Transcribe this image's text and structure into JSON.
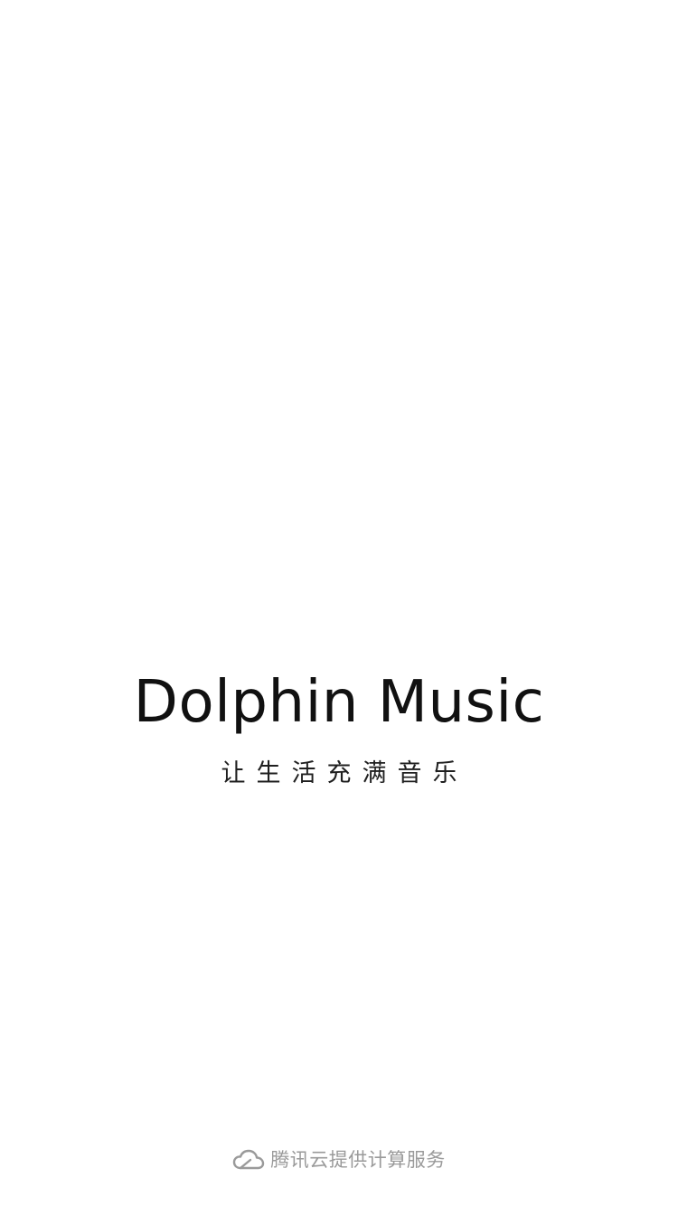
{
  "splash": {
    "title": "Dolphin Music",
    "tagline": "让生活充满音乐"
  },
  "footer": {
    "icon": "cloud-icon",
    "text": "腾讯云提供计算服务"
  },
  "colors": {
    "background": "#ffffff",
    "title": "#111111",
    "tagline": "#1f1f1f",
    "footer": "#9a9a9a"
  }
}
